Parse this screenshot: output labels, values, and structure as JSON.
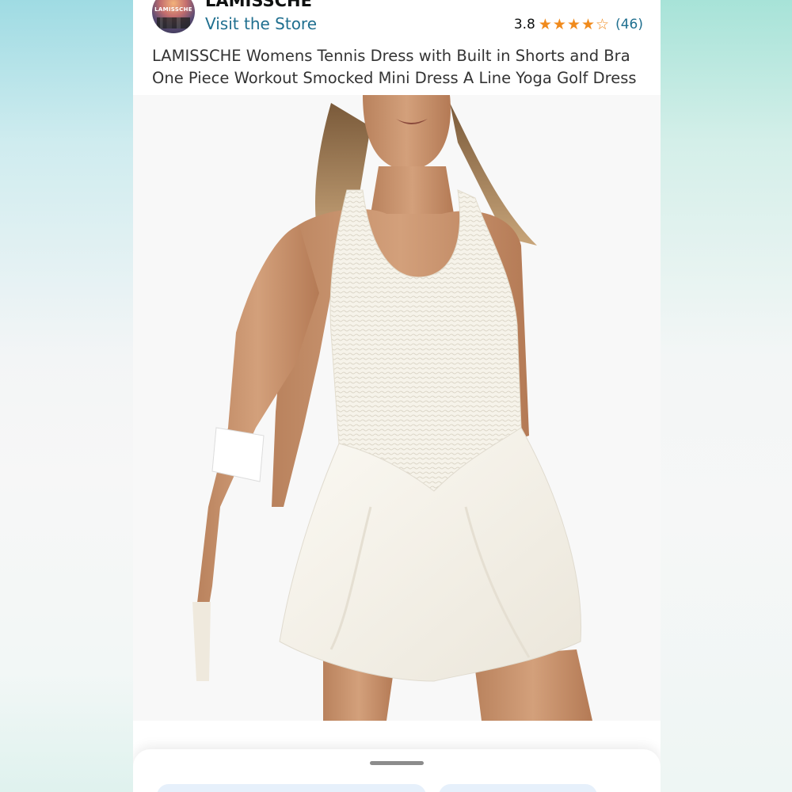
{
  "store": {
    "brand_name": "LAMISSCHE",
    "avatar_text": "LAMISSCHE",
    "visit_label": "Visit the Store"
  },
  "rating": {
    "value": "3.8",
    "stars_filled": 4,
    "stars_total": 5,
    "review_count": "(46)",
    "star_color": "#f08a1c"
  },
  "product": {
    "title": "LAMISSCHE Womens Tennis Dress with Built in Shorts and Bra One Piece Workout Smocked Mini Dress A Line Yoga Golf Dress",
    "image_alt": "Woman wearing white smocked tennis mini dress"
  },
  "colors": {
    "link": "#1f6f8f",
    "text": "#333333"
  }
}
